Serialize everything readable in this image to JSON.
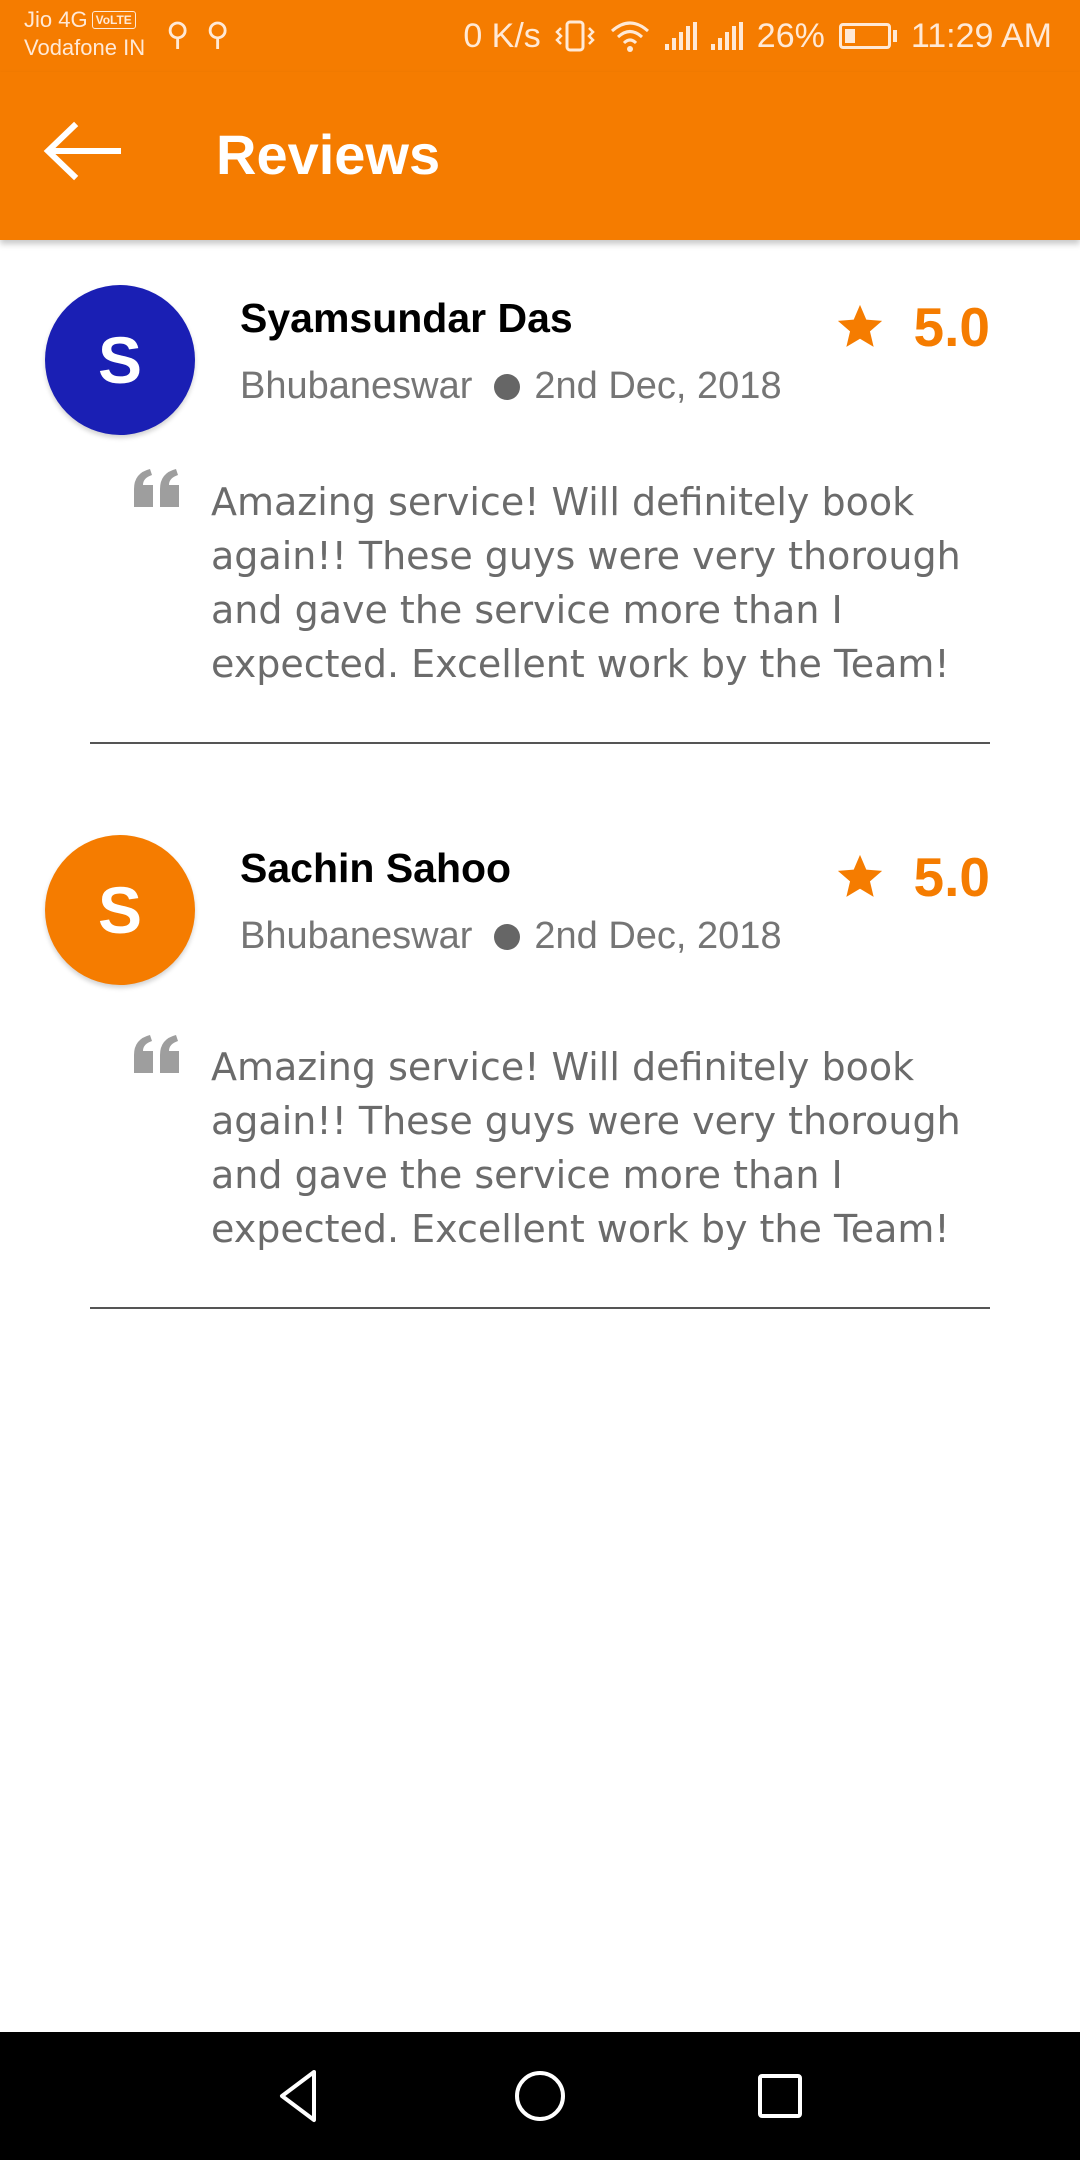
{
  "status_bar": {
    "carrier_1": "Jio 4G",
    "volte": "VoLTE",
    "carrier_2": "Vodafone IN",
    "net_speed": "0 K/s",
    "battery": "26%",
    "battery_level": 0.26,
    "time": "11:29 AM",
    "icons": [
      "usb-icon",
      "usb-icon",
      "vibrate-icon",
      "wifi-icon",
      "signal-icon",
      "signal-icon",
      "battery-icon"
    ]
  },
  "app_bar": {
    "title": "Reviews",
    "back_icon": "arrow-left-icon"
  },
  "reviews": [
    {
      "initial": "S",
      "avatar_color": "#1A1FB4",
      "name": "Syamsundar Das",
      "location": "Bhubaneswar",
      "date": "2nd Dec, 2018",
      "rating": "5.0",
      "comment": "Amazing service! Will definitely book again!! These guys were very thorough and gave the service more than I expected. Excellent work by the Team!"
    },
    {
      "initial": "S",
      "avatar_color": "#F57C00",
      "name": "Sachin Sahoo",
      "location": "Bhubaneswar",
      "date": "2nd Dec, 2018",
      "rating": "5.0",
      "comment": "Amazing service! Will definitely book again!! These guys were very thorough and gave the service more than I expected. Excellent work by the Team!"
    }
  ],
  "nav_bar": {
    "icons": [
      "back-triangle-icon",
      "home-circle-icon",
      "recents-square-icon"
    ]
  },
  "colors": {
    "primary": "#F57C00",
    "secondary_text": "#757575",
    "nav_bar": "#000000"
  }
}
